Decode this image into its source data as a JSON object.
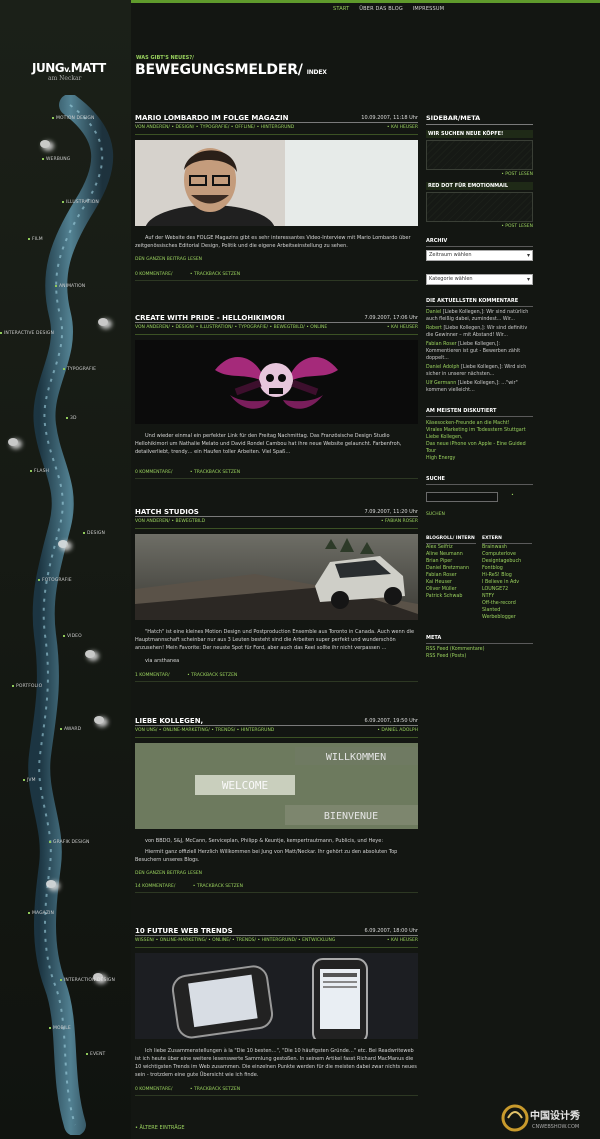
{
  "top_nav": {
    "start": "START",
    "about": "ÜBER DAS BLOG",
    "imprint": "IMPRESSUM"
  },
  "brand": {
    "logo_main": "JUNG",
    "logo_v": "v.",
    "logo_end": "MATT",
    "logo_sub": "am Neckar"
  },
  "header": {
    "kicker": "WAS GIBT'S NEUES?/",
    "title": "BEWEGUNGSMELDER/",
    "subtitle": "INDEX"
  },
  "left_nav": [
    "MOTION DESIGN",
    "WERBUNG",
    "ILLUSTRATION",
    "FILM",
    "ANIMATION",
    "INTERACTIVE DESIGN",
    "TYPOGRAFIE",
    "3D",
    "FLASH",
    "DESIGN",
    "FOTOGRAFIE",
    "VIDEO",
    "PORTFOLIO",
    "AWARD",
    "JVM",
    "GRAFIK DESIGN",
    "MAGAZIN",
    "INTERACTION DESIGN",
    "MOBILE",
    "EVENT"
  ],
  "posts": [
    {
      "title": "MARIO LOMBARDO IM FOLGE MAGAZIN",
      "date": "10.09.2007, 11:18 Uhr",
      "categories": "VON ANDEREN/ • DESIGN/ • TYPOGRAFIE/ • OFFLINE/ • HINTERGRUND",
      "author": "• KAI HEUSER",
      "text": "Auf der Website des FOLGE Magazins gibt es sehr interessantes Video-Interview mit Mario Lombardo über zeitgenössisches Editorial Design, Politik und die eigene Arbeitseinstellung zu sehen.",
      "more": "DEN GANZEN BEITRAG LESEN",
      "comments": "0 KOMMENTARE/",
      "trackback": "• TRACKBACK SETZEN"
    },
    {
      "title": "CREATE WITH PRIDE - HELLOHIKIMORI",
      "date": "7.09.2007, 17:06 Uhr",
      "categories": "VON ANDEREN/ • DESIGN/ • ILLUSTRATION/ • TYPOGRAFIE/ • BEWEGTBILD/ • ONLINE",
      "author": "• KAI HEUSER",
      "text": "Und wieder einmal ein perfekter Link für den Freitag Nachmittag. Das Französische Design Studio Hellohikimori um Nathalie Melato und David Rondel Cambou hat ihre neue Website gelauncht. Farbenfroh, detailverliebt, trendy… ein Haufen toller Arbeiten. Viel Spaß…",
      "comments": "0 KOMMENTARE/",
      "trackback": "• TRACKBACK SETZEN"
    },
    {
      "title": "HATCH STUDIOS",
      "date": "7.09.2007, 11:20 Uhr",
      "categories": "VON ANDEREN/ • BEWEGTBILD",
      "author": "• FABIAN ROSER",
      "text": "\"Hatch\" ist eine kleines Motion Design und Postproduction Ensemble aus Toronto in Canada. Auch wenn die Hauptmannschaft scheinbar nur aus 3 Leuten besteht sind die Arbeiten super perfekt und wunderschön anzusehen! Mein Favorite: Der neuste Spot für Ford, aber auch das Reel sollte ihr nicht verpassen …",
      "via": "via arsthanea",
      "comments": "1 KOMMENTAR/",
      "trackback": "• TRACKBACK SETZEN"
    },
    {
      "title": "LIEBE KOLLEGEN,",
      "date": "6.09.2007, 19:50 Uhr",
      "categories": "VON UNS/ • ONLINE-MARKETING/ • TRENDS/ • HINTERGRUND",
      "author": "• DANIEL ADOLPH",
      "image_words": [
        "WILLKOMMEN",
        "WELCOME",
        "BIENVENUE"
      ],
      "text": "von BBDO, S&J, McCann, Serviceplan, Philipp & Keuntje, kempertrautmann, Publicis, und Heye:",
      "text2": "Hiermit ganz offiziell Herzlich Willkommen bei Jung von Matt/Neckar. Ihr gehört zu den absoluten Top Besuchern unseres Blogs.",
      "more": "DEN GANZEN BEITRAG LESEN",
      "comments": "14 KOMMENTARE/",
      "trackback": "• TRACKBACK SETZEN"
    },
    {
      "title": "10 FUTURE WEB TRENDS",
      "date": "6.09.2007, 18:00 Uhr",
      "categories": "WISSEN/ • ONLINE-MARKETING/ • ONLINE/ • TRENDS/ • HINTERGRUND/ • ENTWICKLUNG",
      "author": "• KAI HEUSER",
      "text": "Ich liebe Zusammenstellungen à la \"Die 10 besten…\", \"Die 10 häufigsten Gründe…\" etc. Bei Readwriteweb ist ich heute über eine weitere lesenswerte Sammlung gestoßen. In seinem Artikel fasst Richard MacManus die 10 wichtigsten Trends im Web zusammen. Die einzelnen Punkte werden für die meisten dabei zwar nichts neues sein - trotzdem eine gute Übersicht wie ich finde.",
      "comments": "0 KOMMENTARE/",
      "trackback": "• TRACKBACK SETZEN"
    }
  ],
  "older": "• ÄLTERE EINTRÄGE",
  "sidebar": {
    "title": "SIDEBAR/META",
    "wanted": "WIR SUCHEN NEUE KÖPFE!",
    "post_read": "• POST LESEN",
    "red_dot": "RED DOT FÜR EMOTIONMAIL",
    "post_read2": "• POST LESEN",
    "archive": "ARCHIV",
    "archive_select": "Zeitraum wählen",
    "category_select": "Kategorie wählen",
    "latest_comments_title": "DIE AKTUELLSTEN KOMMENTARE",
    "latest_comments": [
      {
        "name": "Daniel",
        "text": "[Liebe Kollegen,]: Wir sind natürlich auch fleißig dabei, zumindest... Wir..."
      },
      {
        "name": "Robert",
        "text": "[Liebe Kollegen,]: Wir sind definitiv die Gewinner – mit Abstand! Wir..."
      },
      {
        "name": "Fabian Roser",
        "text": "[Liebe Kollegen,]: Kommentieren ist gut - Bewerben zählt doppelt..."
      },
      {
        "name": "Daniel Adolph",
        "text": "[Liebe Kollegen,]: Wird sich sicher in unserer nächsten..."
      },
      {
        "name": "Ulf Germann",
        "text": "[Liebe Kollegen,]: …\"wir\" kommen vielleicht…"
      }
    ],
    "most_discussed_title": "AM MEISTEN DISKUTIERT",
    "most_discussed": [
      "Käsesocken-Freunde an die Macht!",
      "Virales Marketing im Todesstern Stuttgart",
      "Liebe Kollegen,",
      "Das neue iPhone von Apple - Eine Guided Tour",
      "High Energy"
    ],
    "search_title": "SUCHE",
    "search_button": "• SUCHEN",
    "blogroll_intern": "BLOGROLL/ INTERN",
    "blogroll_extern": "EXTERN",
    "intern": [
      "Alex Seifriz",
      "Aline Neumann",
      "Brian Piper",
      "Daniel Bretzmann",
      "Fabian Roser",
      "Kai Heuser",
      "Oliver Müller",
      "Patrick Schwab"
    ],
    "extern": [
      "Brainwash",
      "Computerlove",
      "Designtagebuch",
      "Fontblog",
      "Hi-ReS! Blog",
      "I Believe in Adv",
      "LOUNGE72",
      "NTFY",
      "Off-the-record",
      "Slanted",
      "Werbeblogger"
    ],
    "meta_title": "META",
    "meta_links": [
      "RSS Feed (Kommentare)",
      "RSS Feed (Posts)"
    ]
  },
  "watermark": {
    "cn": "中国设计秀",
    "url": "CNWEBSHOW.COM"
  }
}
